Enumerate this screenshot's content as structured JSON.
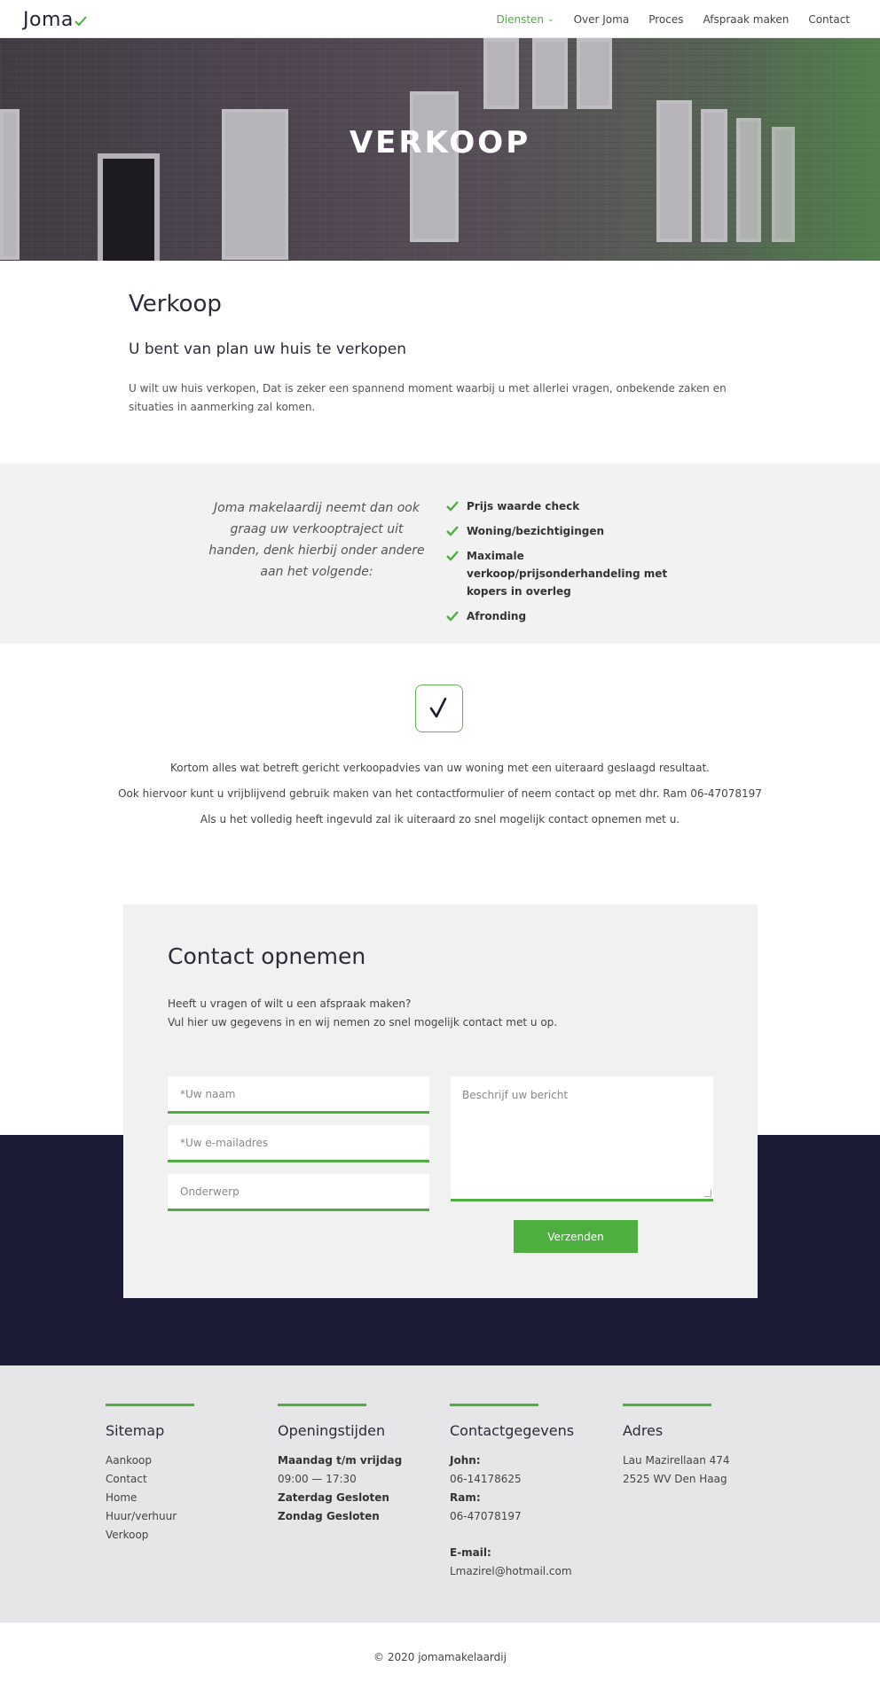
{
  "header": {
    "logo_text": "Joma",
    "nav": [
      {
        "label": "Diensten",
        "active": true,
        "has_dropdown": true
      },
      {
        "label": "Over Joma"
      },
      {
        "label": "Proces"
      },
      {
        "label": "Afspraak maken"
      },
      {
        "label": "Contact"
      }
    ]
  },
  "hero": {
    "title": "VERKOOP"
  },
  "intro": {
    "title": "Verkoop",
    "subtitle": "U bent van plan uw huis te verkopen",
    "text": "U wilt uw huis verkopen, Dat is zeker een spannend moment waarbij u met allerlei vragen, onbekende zaken en situaties in aanmerking zal komen."
  },
  "band": {
    "quote": "Joma makelaardij neemt dan ook graag uw verkooptraject uit handen, denk hierbij onder andere aan het volgende:",
    "items": [
      "Prijs waarde check",
      "Woning/bezichtigingen",
      "Maximale verkoop/prijsonderhandeling met kopers in overleg",
      "Afronding"
    ]
  },
  "info": {
    "line1": "Kortom alles wat betreft gericht verkoopadvies van uw woning met een uiteraard geslaagd resultaat.",
    "line2": "Ook hiervoor kunt u vrijblijvend gebruik maken van het contactformulier of neem contact op met dhr. Ram 06-47078197",
    "line3": "Als u het volledig heeft ingevuld zal ik uiteraard zo snel mogelijk contact opnemen met u."
  },
  "contact": {
    "title": "Contact opnemen",
    "lead_1": "Heeft u vragen of wilt u een afspraak maken?",
    "lead_2": "Vul hier uw gegevens in en wij nemen zo snel mogelijk contact met u op.",
    "name_placeholder": "*Uw naam",
    "email_placeholder": "*Uw e-mailadres",
    "subject_placeholder": "Onderwerp",
    "message_placeholder": "Beschrijf uw bericht",
    "submit_label": "Verzenden"
  },
  "footer": {
    "sitemap": {
      "title": "Sitemap",
      "links": [
        "Aankoop",
        "Contact",
        "Home",
        "Huur/verhuur",
        "Verkoop"
      ]
    },
    "hours": {
      "title": "Openingstijden",
      "weekday_label": "Maandag t/m vrijdag",
      "weekday_time": "09:00 — 17:30",
      "saturday": "Zaterdag Gesloten",
      "sunday": "Zondag Gesloten"
    },
    "contact": {
      "title": "Contactgegevens",
      "john_label": "John:",
      "john_phone": "06-14178625",
      "ram_label": "Ram:",
      "ram_phone": "06-47078197",
      "email_label": "E-mail:",
      "email": "Lmazirel@hotmail.com"
    },
    "address": {
      "title": "Adres",
      "street": "Lau Mazirellaan 474",
      "city": "2525 WV Den Haag"
    },
    "copyright": "© 2020 jomamakelaardij"
  },
  "colors": {
    "accent": "#4caf3e",
    "dark": "#1c1b36",
    "grey_band": "#f2f2f2",
    "footer": "#e6e6e8"
  }
}
